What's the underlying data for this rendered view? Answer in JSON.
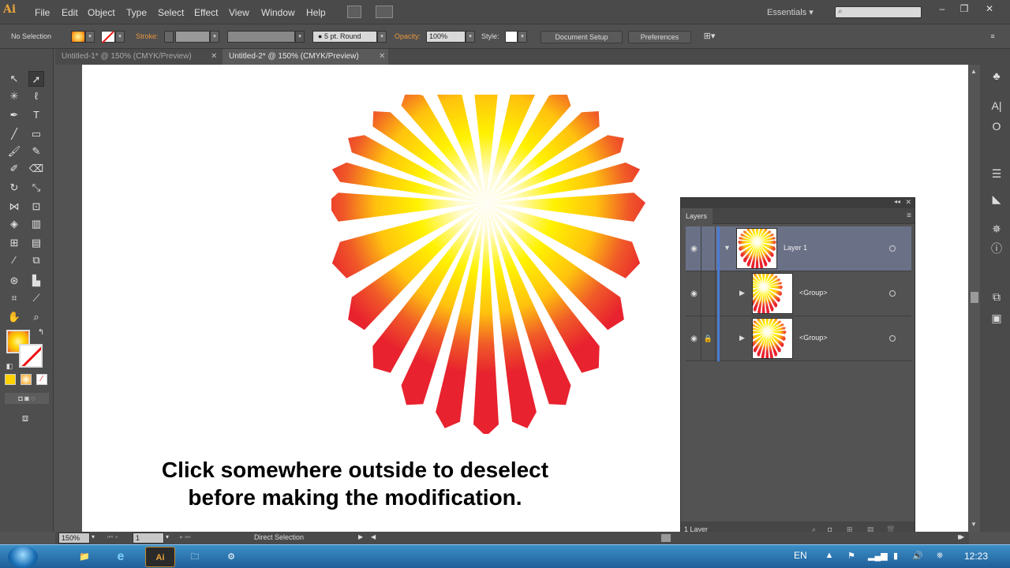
{
  "app": {
    "logo_text": "Ai",
    "menus": [
      "File",
      "Edit",
      "Object",
      "Type",
      "Select",
      "Effect",
      "View",
      "Window",
      "Help"
    ],
    "workspace": "Essentials",
    "search_placeholder": ""
  },
  "control_bar": {
    "selection_status": "No Selection",
    "stroke_label": "Stroke:",
    "brush_profile": "5 pt. Round",
    "opacity_label": "Opacity:",
    "opacity_value": "100%",
    "style_label": "Style:",
    "document_setup_label": "Document Setup",
    "preferences_label": "Preferences"
  },
  "tabs": [
    {
      "label": "Untitled-1* @ 150% (CMYK/Preview)",
      "active": false
    },
    {
      "label": "Untitled-2* @ 150% (CMYK/Preview)",
      "active": true
    }
  ],
  "caption": {
    "line1": "Click somewhere outside to deselect",
    "line2": "before making the modification."
  },
  "artwork": {
    "ray_count": 24,
    "colors": {
      "center": "#fffdf0",
      "mid": "#ffe400",
      "edge": "#e8222e"
    }
  },
  "layers_panel": {
    "title": "Layers",
    "rows": [
      {
        "name": "Layer 1",
        "expanded": true,
        "locked": false,
        "visible": true,
        "selected": true
      },
      {
        "name": "<Group>",
        "expanded": false,
        "locked": false,
        "visible": true,
        "selected": false
      },
      {
        "name": "<Group>",
        "expanded": false,
        "locked": true,
        "visible": true,
        "selected": false
      }
    ],
    "footer": "1 Layer"
  },
  "status_bar": {
    "zoom": "150%",
    "artboard_number": "1",
    "current_tool": "Direct Selection"
  },
  "taskbar": {
    "language": "EN",
    "clock": "12:23",
    "apps": [
      "Windows Explorer",
      "Internet Explorer",
      "Adobe Illustrator",
      "Folder",
      "Utility"
    ]
  },
  "colors": {
    "accent": "#e8953c",
    "layer_selection": "#6a7187",
    "layer_color_bar": "#4a7bd6"
  }
}
